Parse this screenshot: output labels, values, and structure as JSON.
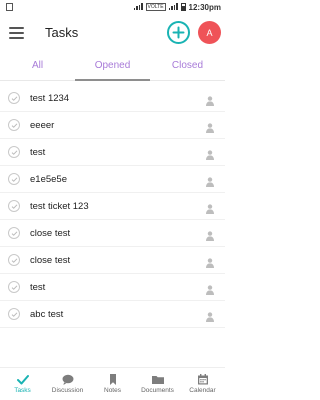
{
  "status_bar": {
    "network_badge": "VOLTE",
    "time": "12:30pm"
  },
  "app_bar": {
    "title": "Tasks",
    "avatar_letter": "A"
  },
  "tabs": [
    {
      "label": "All",
      "active": false
    },
    {
      "label": "Opened",
      "active": true
    },
    {
      "label": "Closed",
      "active": false
    }
  ],
  "tasks": [
    {
      "name": "test 1234"
    },
    {
      "name": "eeeer"
    },
    {
      "name": "test"
    },
    {
      "name": "e1e5e5e"
    },
    {
      "name": "test ticket 123"
    },
    {
      "name": "close test"
    },
    {
      "name": "close test"
    },
    {
      "name": "test"
    },
    {
      "name": "abc test"
    }
  ],
  "bottom_nav": [
    {
      "label": "Tasks",
      "icon": "tasks-icon",
      "active": true
    },
    {
      "label": "Discussion",
      "icon": "chat-icon",
      "active": false
    },
    {
      "label": "Notes",
      "icon": "bookmark-icon",
      "active": false
    },
    {
      "label": "Documents",
      "icon": "folder-icon",
      "active": false
    },
    {
      "label": "Calendar",
      "icon": "calendar-icon",
      "active": false
    }
  ],
  "colors": {
    "accent": "#19b3b3",
    "tab_text": "#a87bd8",
    "avatar": "#ef5358"
  }
}
